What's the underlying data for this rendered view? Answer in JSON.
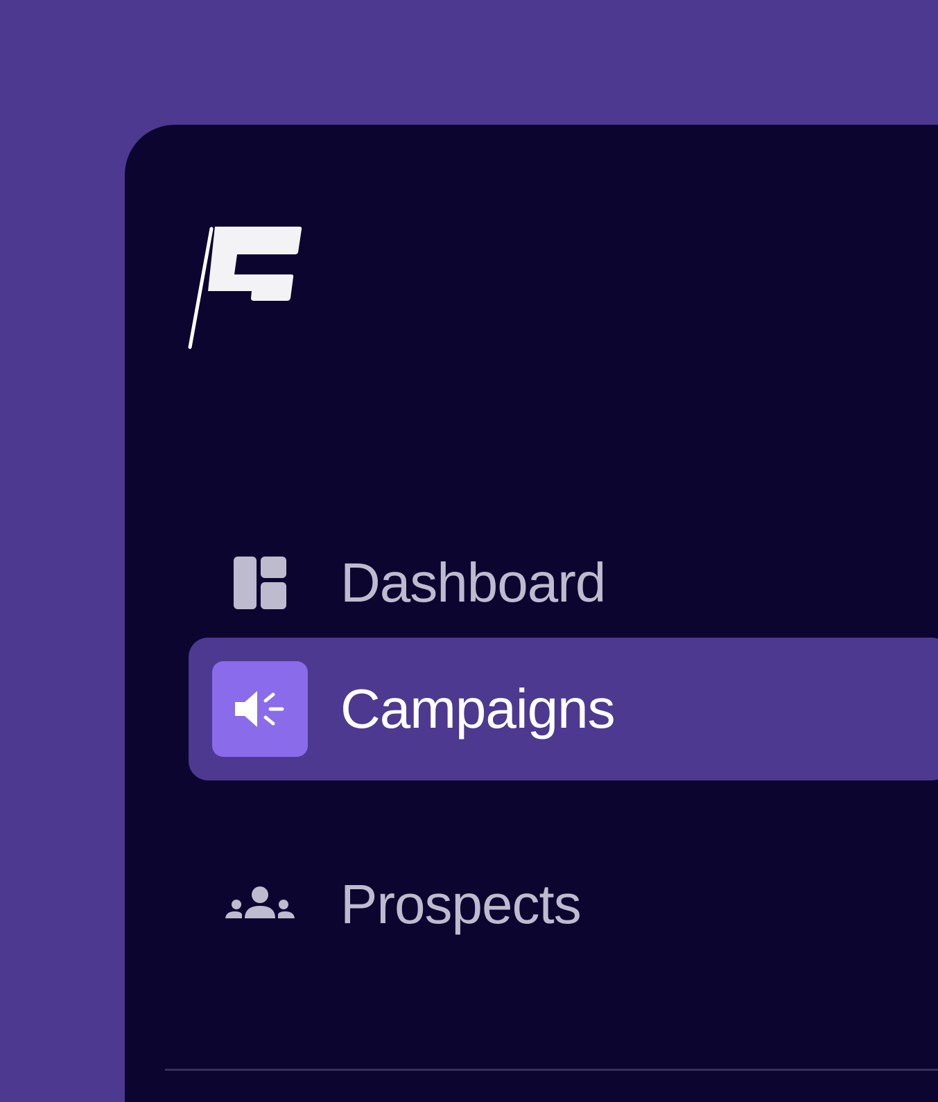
{
  "app": {
    "logo_name": "flag-logo"
  },
  "nav": {
    "items": [
      {
        "label": "Dashboard",
        "icon": "dashboard-icon",
        "active": false
      },
      {
        "label": "Campaigns",
        "icon": "megaphone-icon",
        "active": true
      },
      {
        "label": "Prospects",
        "icon": "people-icon",
        "active": false
      }
    ]
  },
  "colors": {
    "page_background": "#4d3990",
    "sidebar_background": "#0b0530",
    "active_item_background": "#4d3990",
    "active_icon_background": "#8a6bea",
    "inactive_text": "#bfbbcf",
    "active_text": "#ffffff"
  }
}
